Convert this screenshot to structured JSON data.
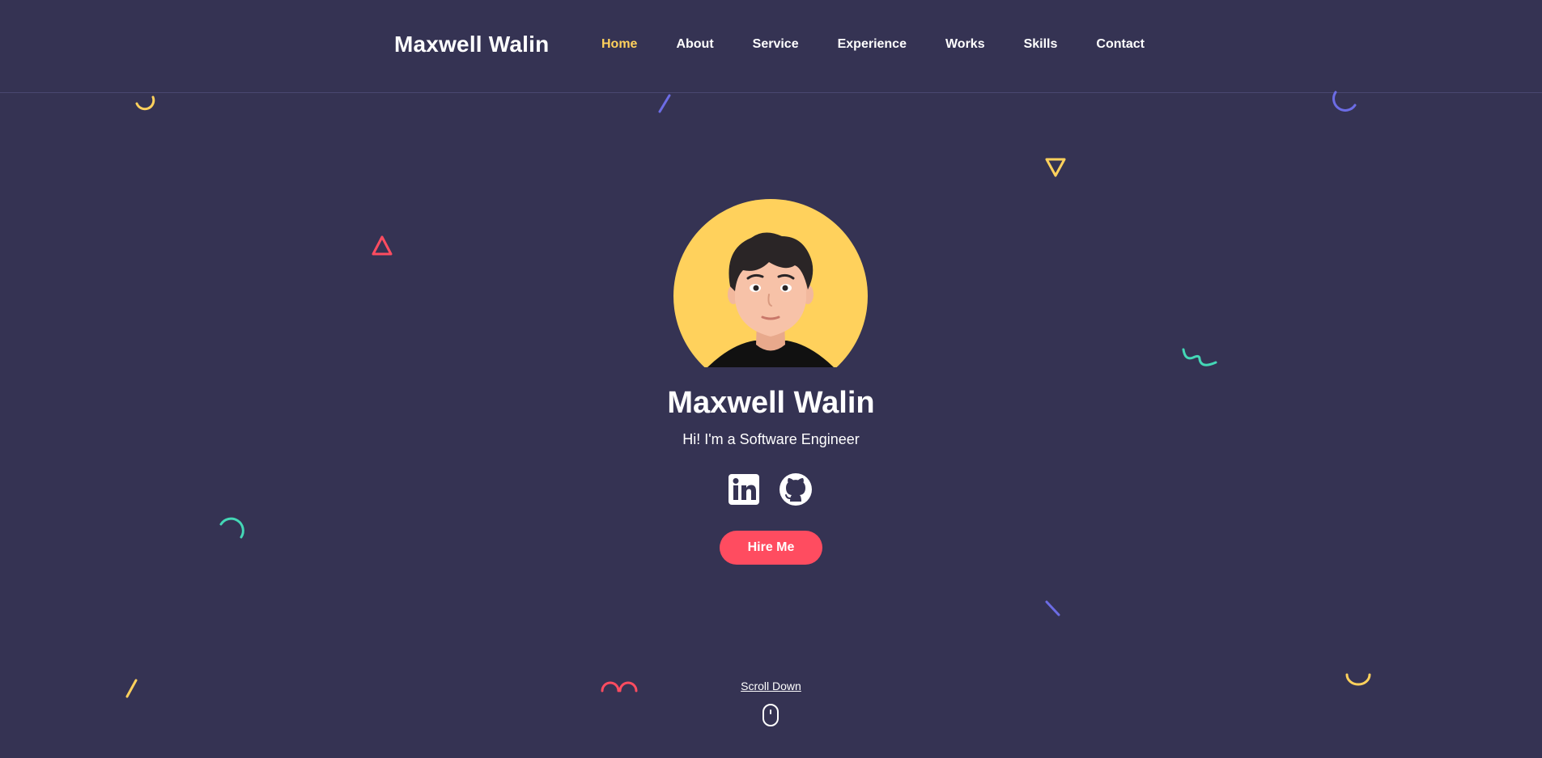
{
  "header": {
    "brand": "Maxwell Walin",
    "nav": [
      "Home",
      "About",
      "Service",
      "Experience",
      "Works",
      "Skills",
      "Contact"
    ],
    "active_nav": "Home"
  },
  "hero": {
    "name": "Maxwell Walin",
    "subtitle": "Hi! I'm a Software Engineer",
    "hire_button": "Hire Me",
    "scroll_label": "Scroll Down",
    "social_icons": [
      "linkedin-icon",
      "github-icon"
    ]
  },
  "colors": {
    "background": "#353353",
    "accent_yellow": "#ffd15c",
    "accent_red": "#ff4c60",
    "accent_purple": "#6c6ce5",
    "accent_teal": "#44d7b6"
  }
}
